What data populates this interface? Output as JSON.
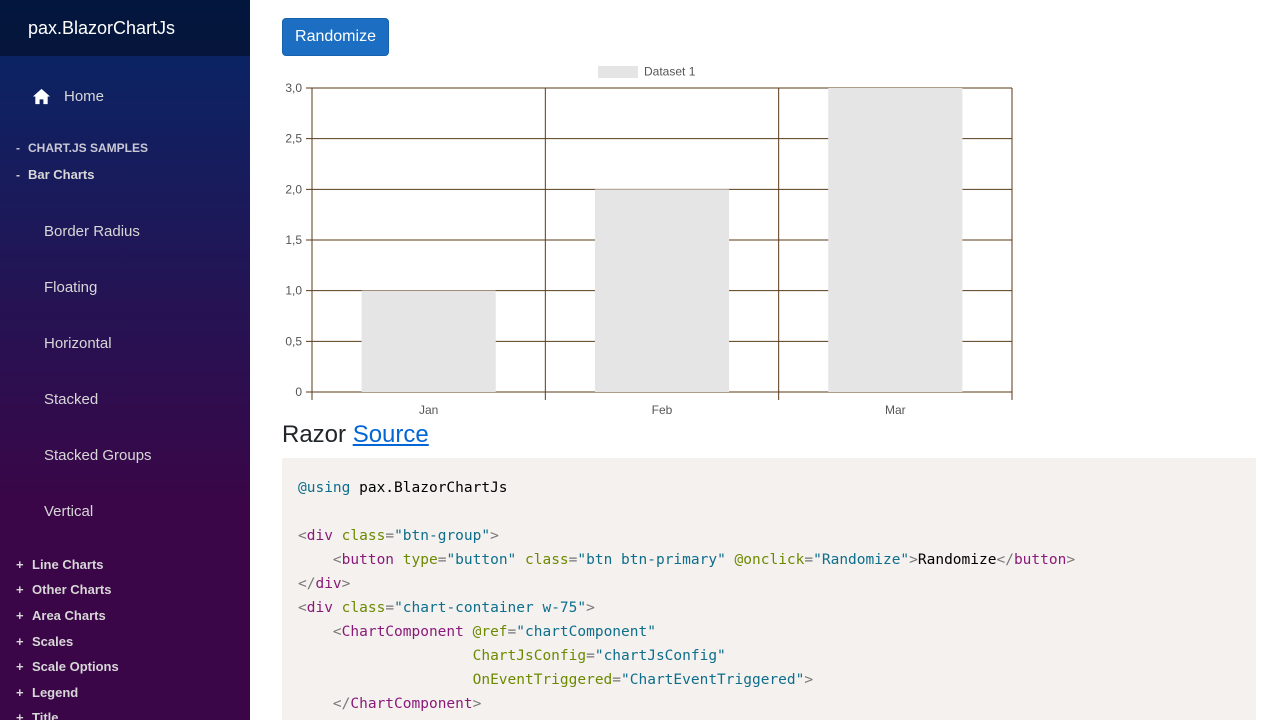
{
  "sidebar": {
    "brand": "pax.BlazorChartJs",
    "home_label": "Home",
    "section_samples": {
      "sign": "-",
      "label": "CHART.JS SAMPLES"
    },
    "section_bar": {
      "sign": "-",
      "label": "Bar Charts"
    },
    "bar_items": [
      "Border Radius",
      "Floating",
      "Horizontal",
      "Stacked",
      "Stacked Groups",
      "Vertical"
    ],
    "groups": [
      {
        "sign": "+",
        "label": "Line Charts"
      },
      {
        "sign": "+",
        "label": "Other Charts"
      },
      {
        "sign": "+",
        "label": "Area Charts"
      },
      {
        "sign": "+",
        "label": "Scales"
      },
      {
        "sign": "+",
        "label": "Scale Options"
      },
      {
        "sign": "+",
        "label": "Legend"
      },
      {
        "sign": "+",
        "label": "Title"
      }
    ]
  },
  "main": {
    "randomize_label": "Randomize",
    "razor_label": "Razor",
    "source_link": "Source"
  },
  "code": {
    "line1": {
      "kw": "@using",
      "rest": " pax.BlazorChartJs"
    },
    "div_open": "div",
    "class_attr": "class",
    "btn_group": "\"btn-group\"",
    "button_tag": "button",
    "type_attr": "type",
    "type_val": "\"button\"",
    "btn_class_val": "\"btn btn-primary\"",
    "onclick_attr": "@onclick",
    "onclick_val": "\"Randomize\"",
    "button_text": "Randomize",
    "chart_container_val": "\"chart-container w-75\"",
    "chart_component": "ChartComponent",
    "ref_attr": "@ref",
    "ref_val": "\"chartComponent\"",
    "config_attr": "ChartJsConfig",
    "config_val": "\"chartJsConfig\"",
    "event_attr": "OnEventTriggered",
    "event_val": "\"ChartEventTriggered\""
  },
  "chart_data": {
    "type": "bar",
    "categories": [
      "Jan",
      "Feb",
      "Mar"
    ],
    "series": [
      {
        "name": "Dataset 1",
        "values": [
          1,
          2,
          3
        ],
        "color": "#e5e5e5"
      }
    ],
    "ylim": [
      0,
      3
    ],
    "yticks": [
      "0",
      "0,5",
      "1,0",
      "1,5",
      "2,0",
      "2,5",
      "3,0"
    ],
    "grid": true,
    "grid_color": "#5a3a1a",
    "legend": "top"
  }
}
